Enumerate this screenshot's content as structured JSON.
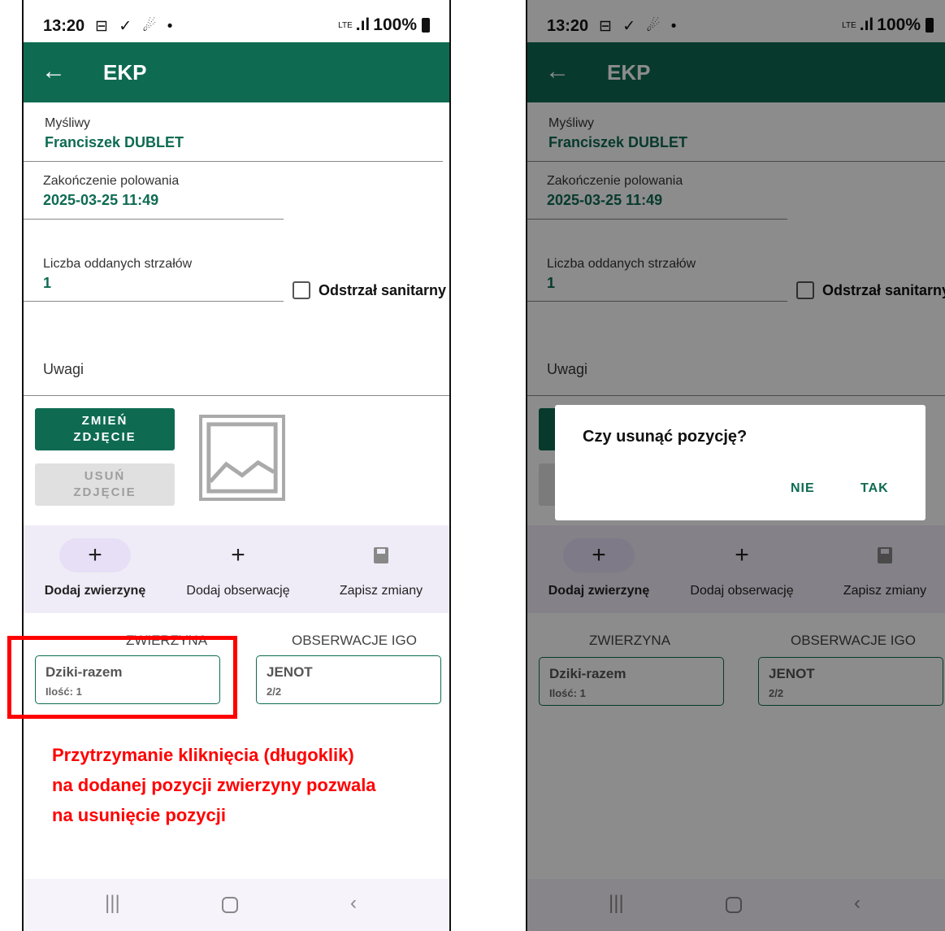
{
  "status": {
    "time": "13:20",
    "icons": "⊟ ✓ ☄ •",
    "network": "LTE",
    "battery": "100%"
  },
  "appbar": {
    "title": "EKP"
  },
  "form": {
    "hunter_label": "Myśliwy",
    "hunter_value": "Franciszek DUBLET",
    "end_label": "Zakończenie polowania",
    "end_value": "2025-03-25 11:49",
    "shots_label": "Liczba oddanych strzałów",
    "shots_value": "1",
    "sanitary_label": "Odstrzał sanitarny",
    "notes_label": "Uwagi"
  },
  "photo": {
    "change_label": "ZMIEŃ ZDJĘCIE",
    "delete_label": "USUŃ ZDJĘCIE"
  },
  "actions": {
    "add_game_label": "Dodaj zwierzynę",
    "add_observation_label": "Dodaj obserwację",
    "save_label": "Zapisz zmiany"
  },
  "sections": {
    "game_header": "ZWIERZYNA",
    "observations_header": "OBSERWACJE IGO",
    "game_item": {
      "name": "Dziki-razem",
      "qty": "Ilość: 1"
    },
    "observation_item": {
      "name": "JENOT",
      "count": "2/2"
    }
  },
  "annotation": {
    "text": "Przytrzymanie kliknięcia (długoklik) na dodanej pozycji zwierzyny pozwala na usunięcie pozycji"
  },
  "dialog": {
    "message": "Czy  usunąć pozycję?",
    "no_label": "NIE",
    "yes_label": "TAK"
  },
  "colors": {
    "primary": "#0e6b52",
    "annotation": "#ff0000"
  }
}
